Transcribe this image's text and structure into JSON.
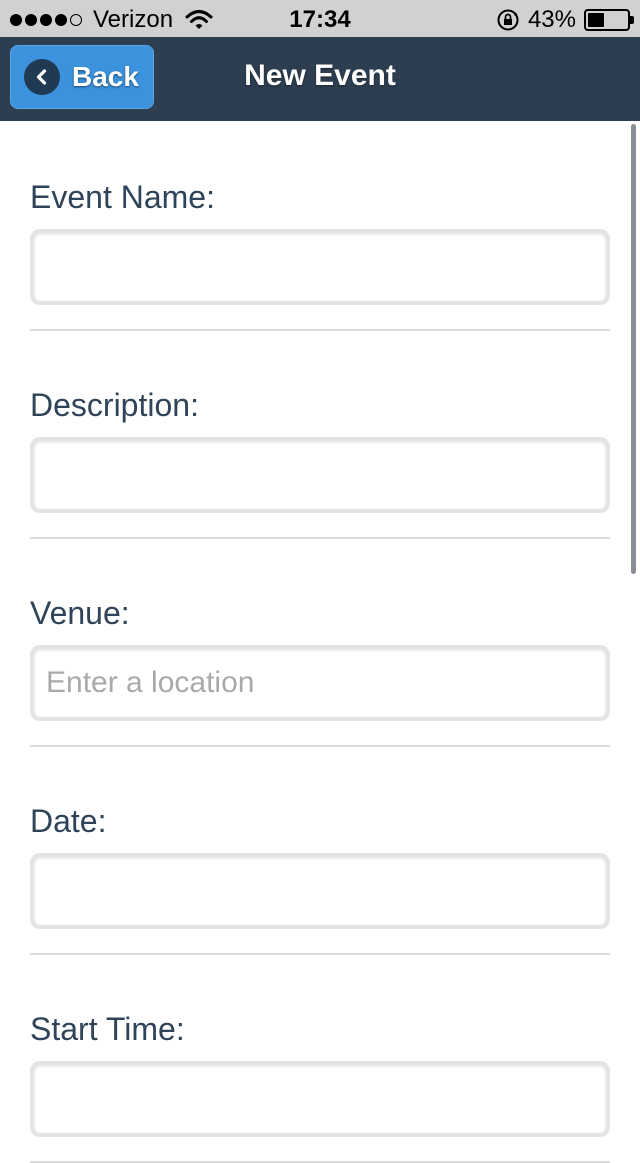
{
  "status_bar": {
    "carrier": "Verizon",
    "time": "17:34",
    "battery_percent": "43%",
    "battery_level": 0.43,
    "signal_bars_filled": 4,
    "signal_bars_total": 5,
    "icons": [
      "signal-icon",
      "wifi-icon",
      "rotation-lock-icon",
      "battery-icon"
    ]
  },
  "header": {
    "back_label": "Back",
    "title": "New Event",
    "color": "#2c3e50",
    "back_button_color": "#3c92dc"
  },
  "form": {
    "fields": [
      {
        "label": "Event Name:",
        "value": "",
        "placeholder": ""
      },
      {
        "label": "Description:",
        "value": "",
        "placeholder": ""
      },
      {
        "label": "Venue:",
        "value": "",
        "placeholder": "Enter a location"
      },
      {
        "label": "Date:",
        "value": "",
        "placeholder": ""
      },
      {
        "label": "Start Time:",
        "value": "",
        "placeholder": ""
      }
    ]
  }
}
